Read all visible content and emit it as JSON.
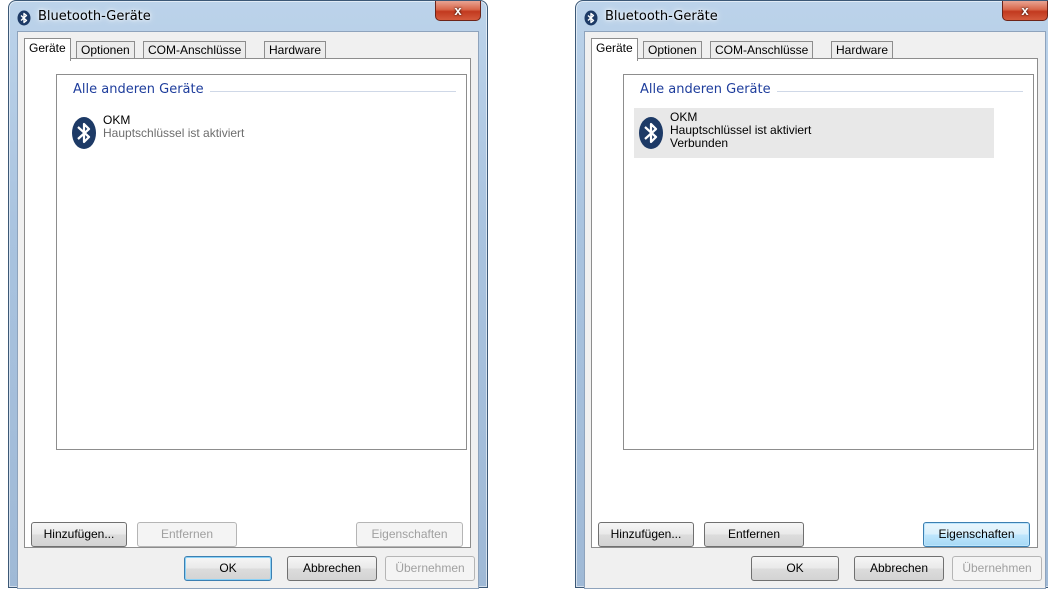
{
  "windows": [
    {
      "title": "Bluetooth-Geräte",
      "close_label": "x",
      "tabs": [
        {
          "label": "Geräte",
          "active": true
        },
        {
          "label": "Optionen",
          "active": false
        },
        {
          "label": "COM-Anschlüsse",
          "active": false
        },
        {
          "label": "Hardware",
          "active": false
        }
      ],
      "group_label": "Alle anderen Geräte",
      "device": {
        "icon": "bluetooth-icon",
        "name": "OKM",
        "status": "Hauptschlüssel ist aktiviert",
        "connection": ""
      },
      "buttons": {
        "add": "Hinzufügen...",
        "remove": "Entfernen",
        "properties": "Eigenschaften",
        "ok": "OK",
        "cancel": "Abbrechen",
        "apply": "Übernehmen"
      }
    },
    {
      "title": "Bluetooth-Geräte",
      "close_label": "x",
      "tabs": [
        {
          "label": "Geräte",
          "active": true
        },
        {
          "label": "Optionen",
          "active": false
        },
        {
          "label": "COM-Anschlüsse",
          "active": false
        },
        {
          "label": "Hardware",
          "active": false
        }
      ],
      "group_label": "Alle anderen Geräte",
      "device": {
        "icon": "bluetooth-icon",
        "name": "OKM",
        "status": "Hauptschlüssel ist aktiviert",
        "connection": "Verbunden"
      },
      "buttons": {
        "add": "Hinzufügen...",
        "remove": "Entfernen",
        "properties": "Eigenschaften",
        "ok": "OK",
        "cancel": "Abbrechen",
        "apply": "Übernehmen"
      }
    }
  ],
  "colors": {
    "group_header": "#1e3d9c",
    "close_button": "#c2391f",
    "bluetooth_icon": "#1d3a66"
  }
}
